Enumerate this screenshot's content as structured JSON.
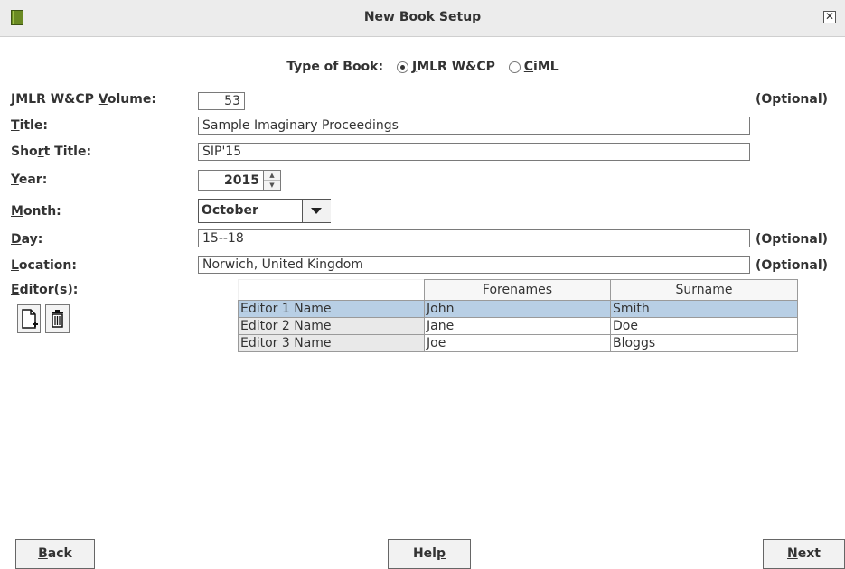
{
  "window": {
    "title": "New Book Setup"
  },
  "type_of_book": {
    "label": "Type of Book:",
    "options": [
      {
        "label": "JMLR W&CP",
        "selected": true
      },
      {
        "label": "CiML",
        "selected": false
      }
    ]
  },
  "fields": {
    "volume": {
      "label": "JMLR W&CP Volume:",
      "value": "53",
      "note": "(Optional)"
    },
    "title": {
      "label": "Title:",
      "value": "Sample Imaginary Proceedings"
    },
    "short_title": {
      "label": "Short Title:",
      "value": "SIP'15"
    },
    "year": {
      "label": "Year:",
      "value": "2015"
    },
    "month": {
      "label": "Month:",
      "value": "October"
    },
    "day": {
      "label": "Day:",
      "value": "15--18",
      "note": "(Optional)"
    },
    "location": {
      "label": "Location:",
      "value": "Norwich, United Kingdom",
      "note": "(Optional)"
    },
    "editors": {
      "label": "Editor(s):"
    }
  },
  "editors_table": {
    "columns": [
      "",
      "Forenames",
      "Surname"
    ],
    "rows": [
      {
        "cells": [
          "Editor 1 Name",
          "John",
          "Smith"
        ],
        "selected": true
      },
      {
        "cells": [
          "Editor 2 Name",
          "Jane",
          "Doe"
        ],
        "selected": false
      },
      {
        "cells": [
          "Editor 3 Name",
          "Joe",
          "Bloggs"
        ],
        "selected": false
      }
    ]
  },
  "icons": {
    "app": "book-icon",
    "add": "new-document-icon",
    "delete": "trash-icon",
    "close": "close-icon"
  },
  "buttons": {
    "back": "Back",
    "help": "Help",
    "next": "Next"
  }
}
